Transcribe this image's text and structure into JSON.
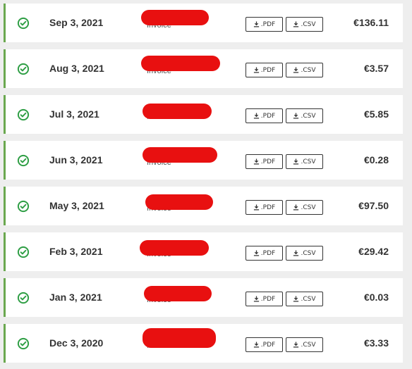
{
  "invoices": [
    {
      "date": "Sep 3, 2021",
      "label": "Invoice",
      "pdf": ".PDF",
      "csv": ".CSV",
      "amount": "€136.11"
    },
    {
      "date": "Aug 3, 2021",
      "label": "Invoice",
      "pdf": ".PDF",
      "csv": ".CSV",
      "amount": "€3.57"
    },
    {
      "date": "Jul 3, 2021",
      "label": "Invoice",
      "pdf": ".PDF",
      "csv": ".CSV",
      "amount": "€5.85"
    },
    {
      "date": "Jun 3, 2021",
      "label": "Invoice",
      "pdf": ".PDF",
      "csv": ".CSV",
      "amount": "€0.28"
    },
    {
      "date": "May 3, 2021",
      "label": "Invoice",
      "pdf": ".PDF",
      "csv": ".CSV",
      "amount": "€97.50"
    },
    {
      "date": "Feb 3, 2021",
      "label": "Invoice",
      "pdf": ".PDF",
      "csv": ".CSV",
      "amount": "€29.42"
    },
    {
      "date": "Jan 3, 2021",
      "label": "Invoice",
      "pdf": ".PDF",
      "csv": ".CSV",
      "amount": "€0.03"
    },
    {
      "date": "Dec 3, 2020",
      "label": "Invoice",
      "pdf": ".PDF",
      "csv": ".CSV",
      "amount": "€3.33"
    }
  ],
  "colors": {
    "accent": "#6aa84f",
    "status_icon": "#2e9e44",
    "redaction": "#e81010"
  },
  "icons": {
    "status": "check-circle-icon",
    "download": "download-icon"
  }
}
